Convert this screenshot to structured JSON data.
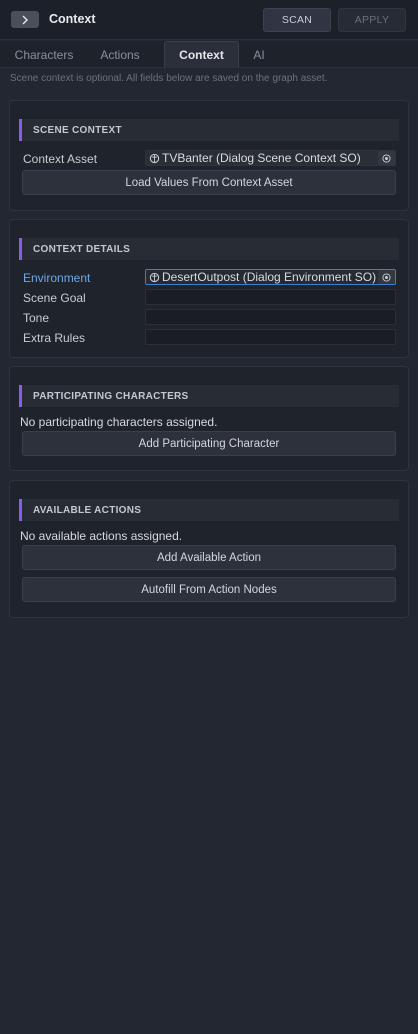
{
  "header": {
    "collapse_glyph": "chevron-right-icon",
    "title": "Context",
    "scan_label": "SCAN",
    "apply_label": "APPLY"
  },
  "tabs": [
    {
      "label": "Characters",
      "active": false
    },
    {
      "label": "Actions",
      "active": false
    },
    {
      "label": "Context",
      "active": true
    },
    {
      "label": "AI",
      "active": false
    }
  ],
  "hint": "Scene context is optional. All fields below are saved on the graph asset.",
  "scene_context": {
    "heading": "SCENE CONTEXT",
    "context_asset_label": "Context Asset",
    "context_asset_value": "TVBanter (Dialog Scene Context SO)",
    "load_button": "Load Values From Context Asset"
  },
  "context_details": {
    "heading": "CONTEXT DETAILS",
    "environment_label": "Environment",
    "environment_value": "DesertOutpost (Dialog Environment SO)",
    "scene_goal_label": "Scene Goal",
    "scene_goal_value": "",
    "tone_label": "Tone",
    "tone_value": "",
    "extra_rules_label": "Extra Rules",
    "extra_rules_value": ""
  },
  "participating_characters": {
    "heading": "PARTICIPATING CHARACTERS",
    "empty_text": "No participating characters assigned.",
    "add_button": "Add Participating Character"
  },
  "available_actions": {
    "heading": "AVAILABLE ACTIONS",
    "empty_text": "No available actions assigned.",
    "add_button": "Add Available Action",
    "autofill_button": "Autofill From Action Nodes"
  },
  "colors": {
    "accent_bar": "#8a5cf2",
    "focus_border": "#3b7fd0",
    "environment_label": "#6fa8e6"
  }
}
